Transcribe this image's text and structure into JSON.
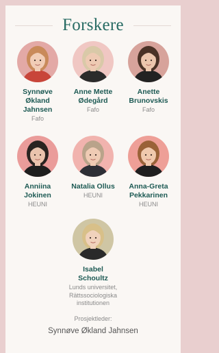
{
  "page": {
    "title": "Forskere"
  },
  "researchers": [
    {
      "name": "Synnøve Økland Jahnsen",
      "name_lines": [
        "Synnøve",
        "Økland",
        "Jahnsen"
      ],
      "org_lines": [
        "Fafo"
      ],
      "avatar_bg": "#e3a9a6",
      "hair": "#c98a5a",
      "skin": "#f1cdb6",
      "cloth": "#c8453a"
    },
    {
      "name": "Anne Mette Ødegård",
      "name_lines": [
        "Anne Mette",
        "Ødegård"
      ],
      "org_lines": [
        "Fafo"
      ],
      "avatar_bg": "#f0c7c3",
      "hair": "#d9c9a8",
      "skin": "#eecab3",
      "cloth": "#2b2b2b"
    },
    {
      "name": "Anette Brunovskis",
      "name_lines": [
        "Anette",
        "Brunovskis"
      ],
      "org_lines": [
        "Fafo"
      ],
      "avatar_bg": "#d7a39b",
      "hair": "#4a3226",
      "skin": "#ecc6ad",
      "cloth": "#222222"
    },
    {
      "name": "Anniina Jokinen",
      "name_lines": [
        "Anniina",
        "Jokinen"
      ],
      "org_lines": [
        "HEUNI"
      ],
      "avatar_bg": "#ea9c9a",
      "hair": "#2a2320",
      "skin": "#eac3ad",
      "cloth": "#1e1e1e"
    },
    {
      "name": "Natalia Ollus",
      "name_lines": [
        "Natalia Ollus"
      ],
      "org_lines": [
        "HEUNI"
      ],
      "avatar_bg": "#f1b3ae",
      "hair": "#b9a38a",
      "skin": "#efcbb4",
      "cloth": "#2d2f36"
    },
    {
      "name": "Anna-Greta Pekkarinen",
      "name_lines": [
        "Anna-Greta",
        "Pekkarinen"
      ],
      "org_lines": [
        "HEUNI"
      ],
      "avatar_bg": "#ee9f97",
      "hair": "#9a6238",
      "skin": "#f0c9ad",
      "cloth": "#1f1f1f"
    },
    {
      "name": "Isabel Schoultz",
      "name_lines": [
        "Isabel",
        "Schoultz"
      ],
      "org_lines": [
        "Lunds universitet,",
        "Rättssociologiska",
        "institutionen"
      ],
      "avatar_bg": "#cfc6a4",
      "hair": "#d8c089",
      "skin": "#f0d2bc",
      "cloth": "#2a2a2a"
    }
  ],
  "footer": {
    "label": "Prosjektleder:",
    "name": "Synnøve Økland Jahnsen"
  }
}
